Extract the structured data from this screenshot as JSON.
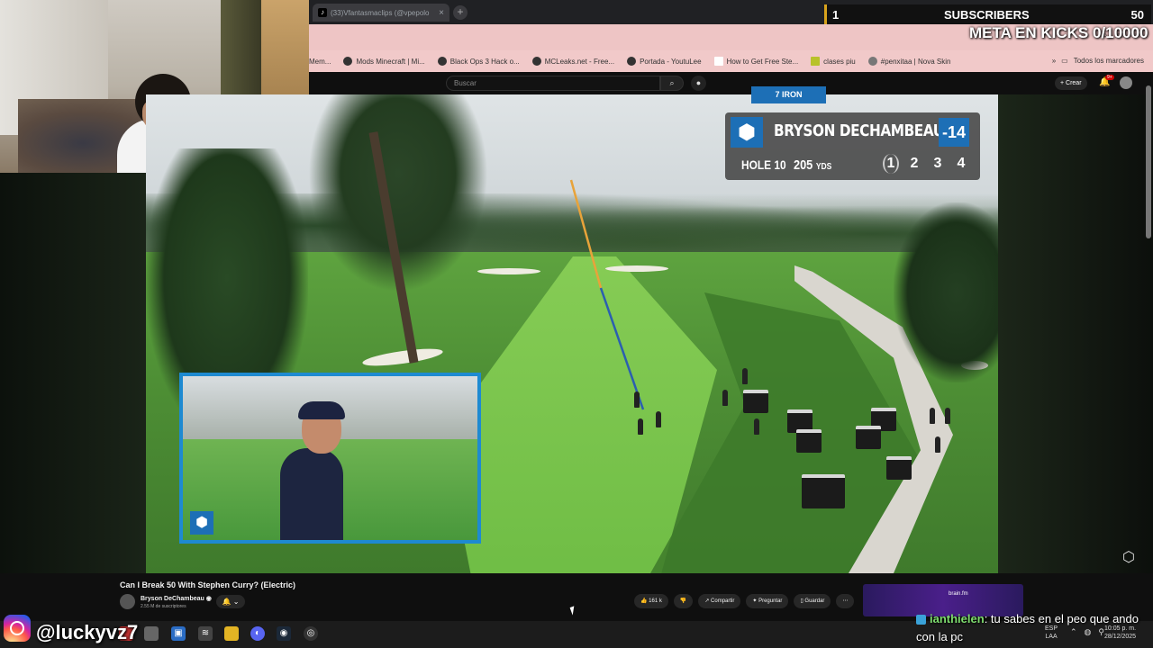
{
  "browser": {
    "tab_title": "(33)Vfantasmaclips (@vpepolo",
    "tab_icon": "tiktok-icon",
    "bookmarks": [
      "Mem...",
      "Mods Minecraft | Mi...",
      "Black Ops 3 Hack o...",
      "MCLeaks.net - Free...",
      "Portada - YoutuLee",
      "How to Get Free Ste...",
      "clases piu",
      "#penxitaa | Nova Skin"
    ],
    "bookmarks_folder": "Todos los marcadores"
  },
  "overlay": {
    "subs_left": "1",
    "subs_label": "SUBSCRIBERS",
    "subs_right": "50",
    "meta_text": "META EN KICKS 0/10000",
    "handle": "@luckyvz7",
    "accent": "#d8a31c"
  },
  "youtube": {
    "search_placeholder": "Buscar",
    "create_label": "+ Crear",
    "bell_badge": "9+"
  },
  "scoreboard": {
    "player": "BRYSON DECHAMBEAU",
    "score": "-14",
    "hole": "HOLE 10",
    "yards": "205",
    "yards_unit": "YDS",
    "shots": [
      "1",
      "2",
      "3",
      "4"
    ],
    "active_shot": "1",
    "club": "7 IRON",
    "brand_color": "#1d6fb6"
  },
  "video_info": {
    "title": "Can I Break 50 With Stephen Curry? (Electric)",
    "channel": "Bryson DeChambeau",
    "subscribers": "2.55 M de suscriptores",
    "likes": "161 k",
    "share": "Compartir",
    "ask": "Preguntar",
    "save": "Guardar",
    "promo_label": "brain.fm"
  },
  "chat": {
    "user": "ianthielen",
    "message": ": tu sabes en el peo que ando con la pc"
  },
  "taskbar": {
    "language": "ESP",
    "region": "LAA",
    "time": "10:05 p. m.",
    "date": "28/12/2025"
  }
}
